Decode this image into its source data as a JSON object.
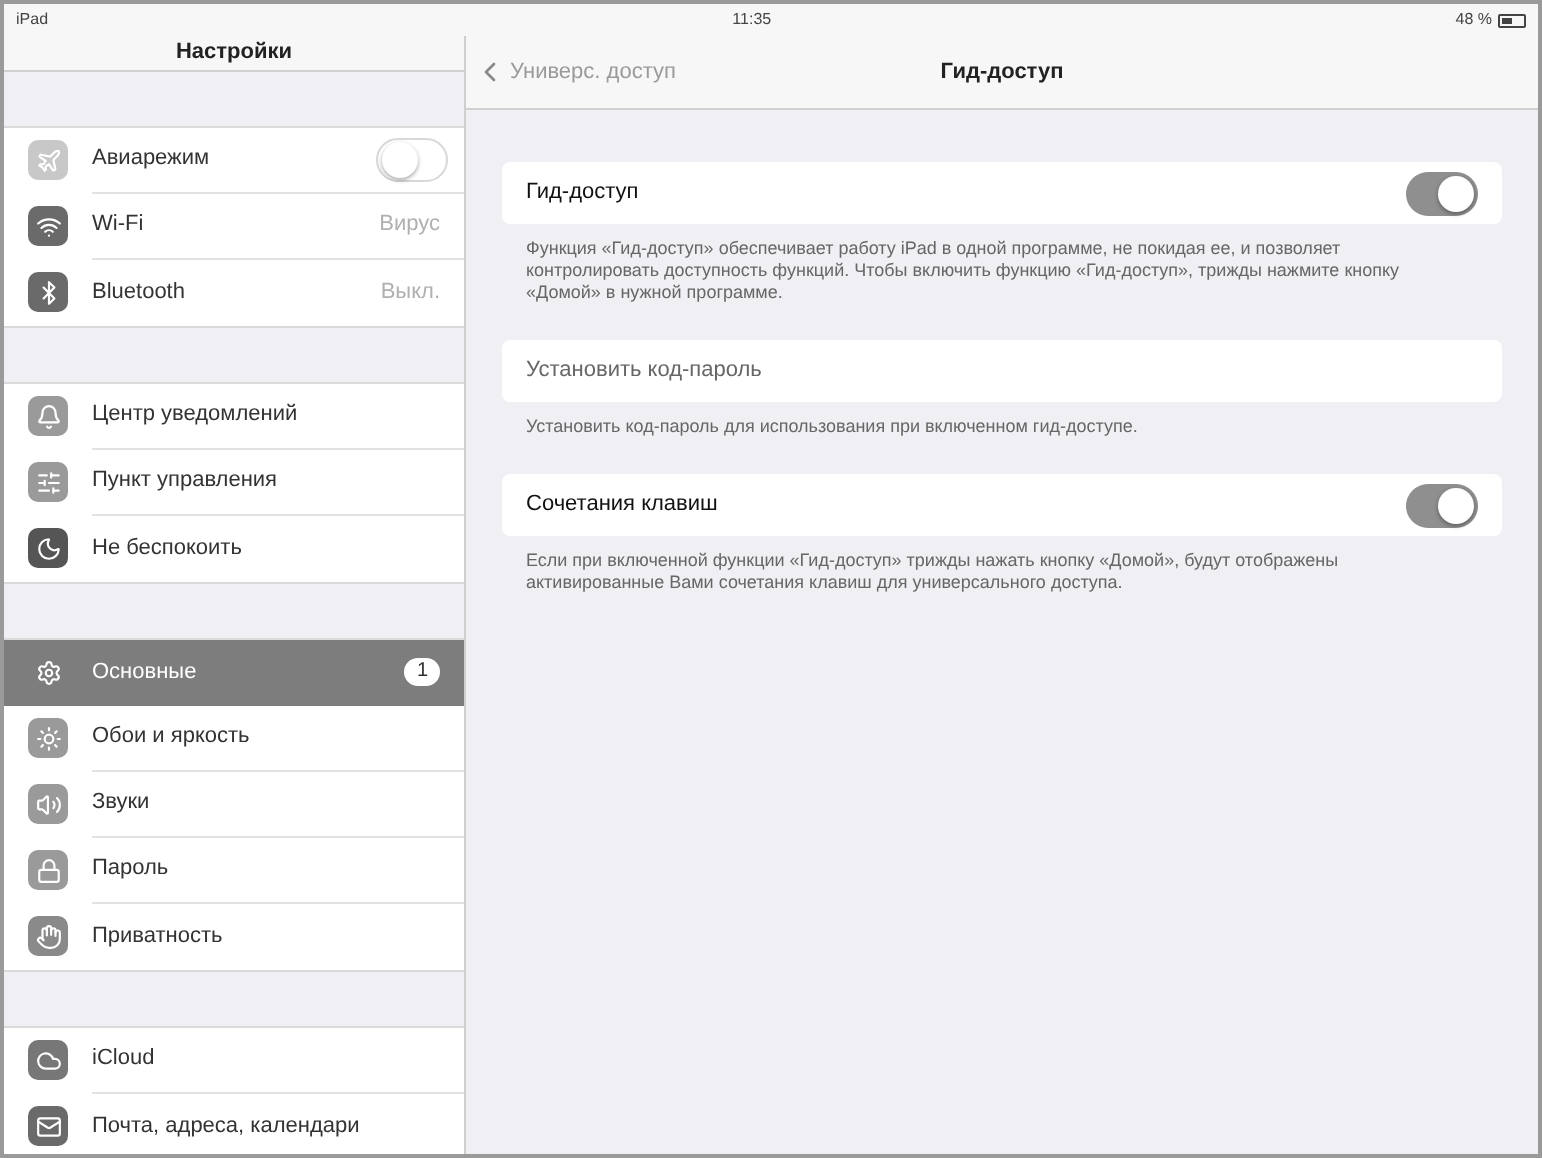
{
  "status_bar": {
    "device": "iPad",
    "time": "11:35",
    "battery": "48 %"
  },
  "sidebar": {
    "title": "Настройки",
    "groups": [
      {
        "items": [
          {
            "label": "Авиарежим",
            "kind": "toggle",
            "on": false,
            "selected": false
          },
          {
            "label": "Wi-Fi",
            "kind": "value",
            "value": "Вирус",
            "selected": false
          },
          {
            "label": "Bluetooth",
            "kind": "value",
            "value": "Выкл.",
            "selected": false
          }
        ]
      },
      {
        "items": [
          {
            "label": "Центр уведомлений",
            "kind": "plain",
            "selected": false
          },
          {
            "label": "Пункт управления",
            "kind": "plain",
            "selected": false
          },
          {
            "label": "Не беспокоить",
            "kind": "plain",
            "selected": false
          }
        ]
      },
      {
        "items": [
          {
            "label": "Основные",
            "kind": "badge",
            "badge": "1",
            "selected": true
          },
          {
            "label": "Обои и яркость",
            "kind": "plain",
            "selected": false
          },
          {
            "label": "Звуки",
            "kind": "plain",
            "selected": false
          },
          {
            "label": "Пароль",
            "kind": "plain",
            "selected": false
          },
          {
            "label": "Приватность",
            "kind": "plain",
            "selected": false
          }
        ]
      },
      {
        "items": [
          {
            "label": "iCloud",
            "kind": "plain",
            "selected": false
          },
          {
            "label": "Почта, адреса, календари",
            "kind": "plain",
            "selected": false
          }
        ]
      }
    ]
  },
  "detail": {
    "back": "Универс. доступ",
    "title": "Гид-доступ",
    "sections": [
      {
        "label": "Гид-доступ",
        "kind": "toggle",
        "on": true,
        "footer": "Функция «Гид-доступ» обеспечивает работу iPad в одной программе, не покидая ее, и позволяет контролировать доступность функций. Чтобы включить функцию «Гид-доступ», трижды нажмите кнопку «Домой» в нужной программе."
      },
      {
        "label": "Установить код-пароль",
        "kind": "link",
        "footer": "Установить код-пароль для использования при включенном гид-доступе."
      },
      {
        "label": "Сочетания клавиш",
        "kind": "toggle",
        "on": true,
        "footer": "Если при включенной функции «Гид-доступ» трижды нажать кнопку «Домой», будут отображены активированные Вами сочетания клавиш для универсального доступа."
      }
    ]
  }
}
